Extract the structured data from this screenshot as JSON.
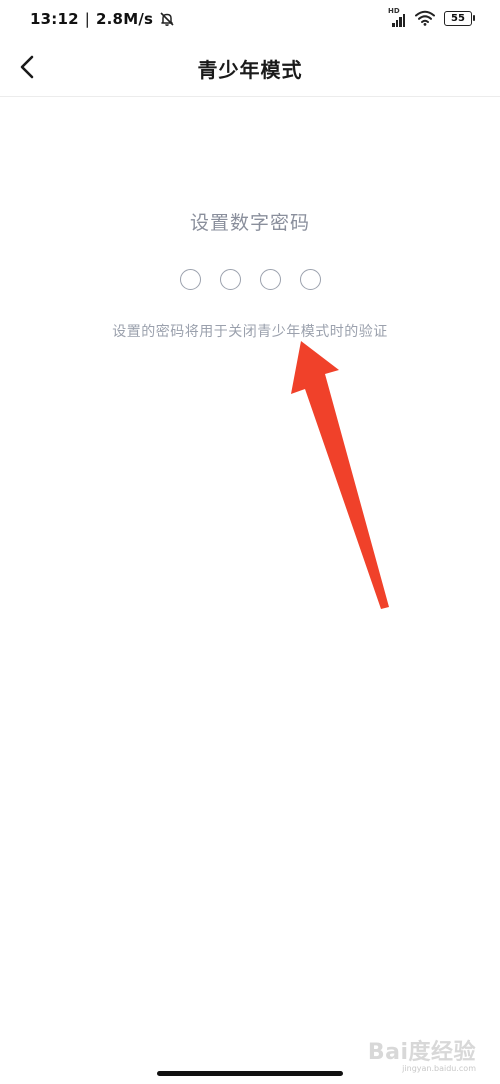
{
  "status_bar": {
    "time": "13:12",
    "separator": "|",
    "speed": "2.8M/s",
    "network_label": "HD",
    "battery": "55",
    "icons": [
      "mute-bell-icon",
      "signal-icon",
      "wifi-icon",
      "battery-icon"
    ]
  },
  "header": {
    "title": "青少年模式",
    "back_icon": "chevron-left-icon"
  },
  "pin": {
    "title": "设置数字密码",
    "digits": [
      "",
      "",
      "",
      ""
    ],
    "hint": "设置的密码将用于关闭青少年模式时的验证"
  },
  "annotation": {
    "arrow_color": "#f0412a"
  },
  "watermark": {
    "main": "Bai度经验",
    "sub": "jingyan.baidu.com"
  }
}
